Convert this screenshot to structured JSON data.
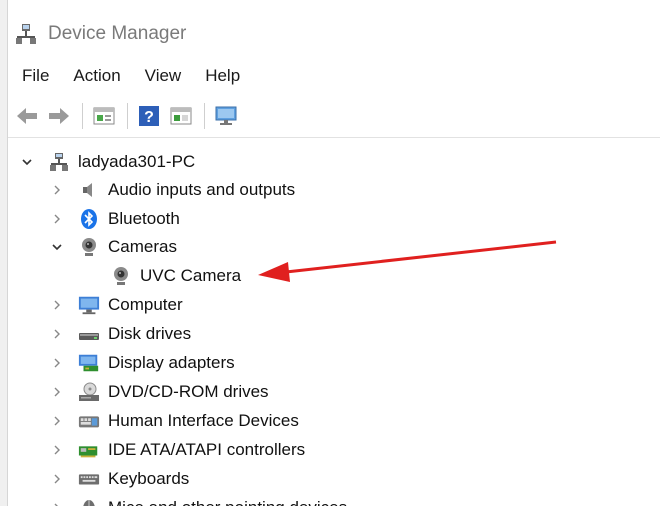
{
  "window": {
    "title": "Device Manager"
  },
  "menu": [
    "File",
    "Action",
    "View",
    "Help"
  ],
  "toolbar": {
    "buttons": [
      "back-arrow-icon",
      "forward-arrow-icon",
      "properties-icon",
      "help-icon",
      "update-driver-icon",
      "monitor-icon"
    ]
  },
  "tree": {
    "root": {
      "label": "ladyada301-PC",
      "expanded": true
    },
    "items": [
      {
        "label": "Audio inputs and outputs",
        "icon": "speaker-icon",
        "expanded": false
      },
      {
        "label": "Bluetooth",
        "icon": "bluetooth-icon",
        "expanded": false
      },
      {
        "label": "Cameras",
        "icon": "webcam-icon",
        "expanded": true
      },
      {
        "label": "UVC Camera",
        "icon": "webcam-icon",
        "child": true
      },
      {
        "label": "Computer",
        "icon": "computer-icon",
        "expanded": false
      },
      {
        "label": "Disk drives",
        "icon": "disk-drive-icon",
        "expanded": false
      },
      {
        "label": "Display adapters",
        "icon": "display-adapter-icon",
        "expanded": false
      },
      {
        "label": "DVD/CD-ROM drives",
        "icon": "dvd-drive-icon",
        "expanded": false
      },
      {
        "label": "Human Interface Devices",
        "icon": "hid-icon",
        "expanded": false
      },
      {
        "label": "IDE ATA/ATAPI controllers",
        "icon": "ide-controller-icon",
        "expanded": false
      },
      {
        "label": "Keyboards",
        "icon": "keyboard-icon",
        "expanded": false
      },
      {
        "label": "Mice and other pointing devices",
        "icon": "mouse-icon",
        "expanded": false
      }
    ]
  },
  "colors": {
    "annotation_arrow": "#e0201f",
    "bluetooth": "#1a73e8",
    "folder_blue": "#3d7fd6"
  }
}
